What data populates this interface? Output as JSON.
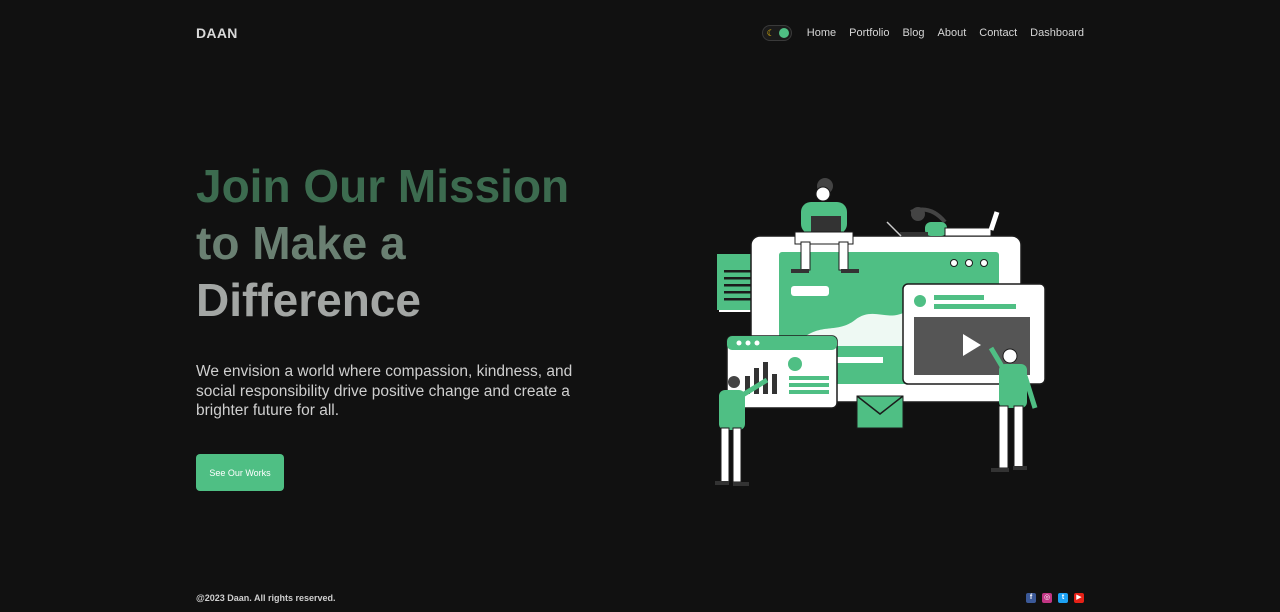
{
  "brand": {
    "name": "DAAN"
  },
  "nav": {
    "items": [
      {
        "label": "Home"
      },
      {
        "label": "Portfolio"
      },
      {
        "label": "Blog"
      },
      {
        "label": "About"
      },
      {
        "label": "Contact"
      },
      {
        "label": "Dashboard"
      }
    ]
  },
  "hero": {
    "title_line1": "Join Our Mission",
    "title_line2": "to Make a",
    "title_line3": "Difference",
    "description": "We envision a world where compassion, kindness, and social responsibility drive positive change and create a brighter future for all.",
    "cta_label": "See Our Works"
  },
  "footer": {
    "copyright": "@2023 Daan. All rights reserved."
  },
  "icons": {
    "theme_toggle": "moon-icon",
    "socials": [
      "facebook-icon",
      "instagram-icon",
      "twitter-icon",
      "youtube-icon"
    ]
  },
  "colors": {
    "accent": "#4fbf84",
    "background": "#111111"
  }
}
